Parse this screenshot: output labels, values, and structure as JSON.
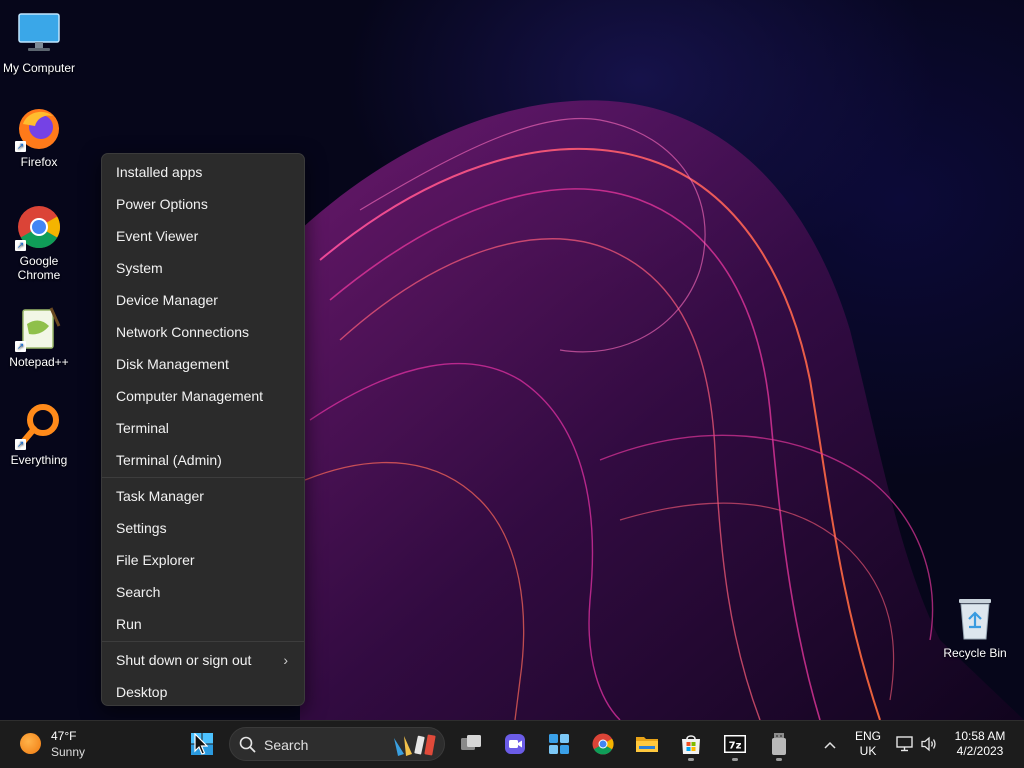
{
  "desktop": {
    "icons": [
      {
        "label": "My Computer",
        "icon": "monitor-icon"
      },
      {
        "label": "Firefox",
        "icon": "firefox-icon"
      },
      {
        "label": "Google Chrome",
        "icon": "chrome-icon"
      },
      {
        "label": "Notepad++",
        "icon": "notepadpp-icon"
      },
      {
        "label": "Everything",
        "icon": "everything-search-icon"
      }
    ],
    "recycle_bin": {
      "label": "Recycle Bin",
      "icon": "recycle-bin-icon"
    }
  },
  "context_menu": {
    "group1": [
      "Installed apps",
      "Power Options",
      "Event Viewer",
      "System",
      "Device Manager",
      "Network Connections",
      "Disk Management",
      "Computer Management",
      "Terminal",
      "Terminal (Admin)"
    ],
    "group2": [
      "Task Manager",
      "Settings",
      "File Explorer",
      "Search",
      "Run"
    ],
    "group3": [
      "Shut down or sign out",
      "Desktop"
    ],
    "submenu_arrow": "›"
  },
  "taskbar": {
    "weather": {
      "temp": "47°F",
      "condition": "Sunny"
    },
    "search": {
      "placeholder": "Search"
    },
    "apps": [
      "start-icon",
      "task-view-icon",
      "meet-icon",
      "widgets-icon",
      "chrome-icon",
      "file-explorer-icon",
      "microsoft-store-icon",
      "7zip-icon",
      "usb-drive-icon"
    ],
    "tray": {
      "chevron": "^",
      "language": {
        "line1": "ENG",
        "line2": "UK"
      },
      "time": "10:58 AM",
      "date": "4/2/2023"
    }
  },
  "colors": {
    "menu_bg": "#2b2b2b",
    "taskbar_bg": "#1c1c1c",
    "accent_magenta": "#c02aa0",
    "accent_orange": "#ff5a3c"
  }
}
